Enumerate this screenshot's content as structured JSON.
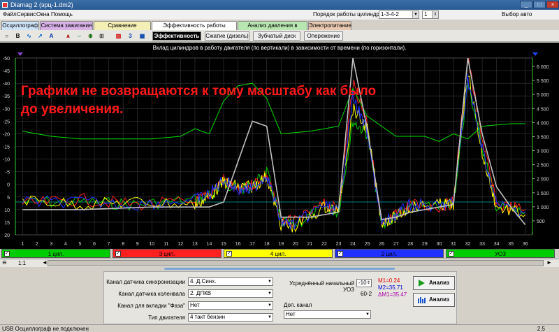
{
  "window": {
    "title": "Diamag 2 (эрц-1.dm2)"
  },
  "menu": {
    "items": [
      "Файл",
      "Сервис",
      "Окна",
      "Помощь"
    ],
    "cyl_order_label": "Порядок работы цилиндров",
    "cyl_order_value": "1-3-4-2",
    "spinner_value": "1",
    "auto_select": "Выбор авто"
  },
  "tabs": [
    {
      "label": "Осциллограф",
      "color": "#cfe3f7"
    },
    {
      "label": "Система зажигания",
      "color": "#d9b2e8"
    },
    {
      "label": "Сравнение цилиндров",
      "color": "#f4efb4"
    },
    {
      "label": "Эффективность работы цилиндров",
      "color": "#ffffff"
    },
    {
      "label": "Анализ давления в цилиндре",
      "color": "#b8e6b0"
    },
    {
      "label": "Электропитание",
      "color": "#e8c8b0"
    }
  ],
  "subtabs": [
    "Эффективность",
    "Сжатие (дизель)",
    "Зубчатый диск",
    "Опережение"
  ],
  "toolbar_icons": [
    "zoom-fit-icon",
    "bold-b-icon",
    "waveform-icon",
    "line-chart-icon",
    "scale-icon",
    "cylinder-icon",
    "expand-icon",
    "marker-icon",
    "compare-icon",
    "bar-chart-icon",
    "counter-icon",
    "grid-icon"
  ],
  "toolbar_icon_glyphs": [
    "○",
    "B",
    "∿",
    "↗",
    "A",
    "ѧ",
    "⇔",
    "⊕",
    "⊞",
    "▥",
    "3",
    "▦"
  ],
  "plot": {
    "title": "Вклад цилиндров в работу двигателя (по вертикали) в зависимости от времени (по горизонтали).",
    "annotation_line1": "Графики не возвращаются к тому масштабу как было",
    "annotation_line2": "до увеличения."
  },
  "chart_data": {
    "type": "line",
    "title": "Вклад цилиндров в работу двигателя (по вертикали) в зависимости от времени (по горизонтали).",
    "x_ticks": [
      1,
      2,
      3,
      4,
      5,
      6,
      7,
      8,
      9,
      10,
      11,
      12,
      13,
      14,
      15,
      16,
      17,
      18,
      19,
      20,
      21,
      22,
      23,
      24,
      25,
      26,
      27,
      28,
      29,
      30,
      31,
      32,
      33,
      34,
      35,
      36
    ],
    "xlim": [
      0.5,
      36.5
    ],
    "y_left_ticks": [
      "-50",
      "-45",
      "-40",
      "-35",
      "-30",
      "-25",
      "-20",
      "-15",
      "-10",
      "-5",
      "0",
      "5",
      "10",
      "15",
      "20"
    ],
    "ylim_left": [
      20,
      -50
    ],
    "y_right_ticks": [
      "6 000",
      "5 500",
      "5 000",
      "4 500",
      "4 000",
      "3 500",
      "3 000",
      "2 500",
      "2 000",
      "1 500",
      "1 000",
      "500"
    ],
    "ylim_right": [
      0,
      6300
    ],
    "grid": true,
    "series": [
      {
        "name": "1 цил.",
        "color": "#00cc00",
        "x": [
          1,
          5,
          9,
          13,
          14,
          15,
          16,
          17,
          18,
          19,
          20,
          22,
          23,
          24,
          25,
          26,
          27,
          28,
          30,
          31,
          32,
          33,
          34,
          36
        ],
        "y": [
          7,
          7,
          8,
          6,
          5,
          -1,
          2,
          1,
          -5,
          15,
          16,
          9,
          11,
          -25,
          -20,
          16,
          13,
          9,
          8,
          8,
          -40,
          -15,
          9,
          11
        ]
      },
      {
        "name": "3 цил.",
        "color": "#ff2020",
        "x": [
          1,
          5,
          9,
          13,
          14,
          15,
          16,
          17,
          18,
          19,
          20,
          22,
          23,
          24,
          25,
          26,
          27,
          28,
          30,
          31,
          32,
          33,
          34,
          36
        ],
        "y": [
          8,
          6,
          8,
          7,
          4,
          -2,
          3,
          0,
          -4,
          14,
          15,
          8,
          10,
          -40,
          -25,
          17,
          12,
          8,
          9,
          7,
          -50,
          -18,
          8,
          10
        ]
      },
      {
        "name": "4 цил.",
        "color": "#ffff00",
        "x": [
          1,
          5,
          9,
          13,
          14,
          15,
          16,
          17,
          18,
          19,
          20,
          22,
          23,
          24,
          25,
          26,
          27,
          28,
          30,
          31,
          32,
          33,
          34,
          36
        ],
        "y": [
          6,
          8,
          7,
          8,
          5,
          -1,
          1,
          1,
          -3,
          16,
          17,
          9,
          10,
          -30,
          -22,
          15,
          13,
          9,
          8,
          8,
          -45,
          -12,
          9,
          12
        ]
      },
      {
        "name": "2 цил.",
        "color": "#2030ff",
        "x": [
          1,
          5,
          9,
          13,
          14,
          15,
          16,
          17,
          18,
          19,
          20,
          22,
          23,
          24,
          25,
          26,
          27,
          28,
          30,
          31,
          32,
          33,
          34,
          36
        ],
        "y": [
          7,
          7,
          8,
          6,
          4,
          -2,
          2,
          2,
          -4,
          15,
          16,
          8,
          11,
          -35,
          -20,
          16,
          12,
          8,
          9,
          7,
          -42,
          -14,
          8,
          11
        ]
      },
      {
        "name": "УОЗ",
        "color": "#00dd00",
        "x": [
          1,
          3,
          5,
          8,
          10,
          12,
          13,
          14,
          15,
          16,
          17,
          18,
          19,
          21,
          23,
          24,
          25,
          27,
          29,
          30,
          31,
          32,
          33,
          35,
          36
        ],
        "y": [
          -21,
          -19,
          -18,
          -18,
          -18,
          -19,
          -22,
          -20,
          -33,
          -39,
          -40,
          -34,
          -20,
          -21,
          -23,
          -38,
          -27,
          -19,
          -19,
          -17,
          -20,
          -18,
          -23,
          -24,
          -24
        ]
      },
      {
        "name": "обороты",
        "color": "#c0c0c0",
        "x": [
          1,
          5,
          10,
          13,
          14,
          15,
          17,
          18,
          19,
          20,
          21,
          22,
          23,
          24,
          25,
          26,
          27,
          28,
          29,
          30,
          31,
          32,
          33,
          34,
          35,
          36
        ],
        "y": [
          10,
          10,
          9,
          9,
          9,
          7,
          -25,
          -23,
          13,
          13,
          13,
          12,
          11,
          -50,
          -22,
          14,
          13,
          11,
          10,
          9,
          8,
          -50,
          -20,
          1,
          9,
          16
        ]
      }
    ]
  },
  "channels": [
    {
      "label": "1 цил.",
      "color": "#00cc00",
      "text_color": "#000000"
    },
    {
      "label": "3 цил.",
      "color": "#ff2020",
      "text_color": "#000000"
    },
    {
      "label": "4 цил.",
      "color": "#ffff00",
      "text_color": "#000000"
    },
    {
      "label": "2 цил.",
      "color": "#2030ff",
      "text_color": "#000000"
    },
    {
      "label": "УОЗ",
      "color": "#00cc00",
      "text_color": "#000000"
    }
  ],
  "zoom": {
    "value": "1:1"
  },
  "form": {
    "sync_label": "Канал датчика синхронизации",
    "sync_value": "4. Д.Синх.",
    "crank_label": "Канал датчика коленвала",
    "crank_value": "2. ДПКВ",
    "phase_label": "Канал для вкладки \"Фаза\"",
    "phase_value": "Нет",
    "engine_label": "Тип двигателя",
    "engine_value": "4 такт бензин",
    "avg_uoz_label": "Усреднённый начальный УОЗ",
    "avg_uoz_value": "-10",
    "ratio": "60-2",
    "m1": "M1=0.24",
    "m2": "M2=35.71",
    "dm1": "ΔM1=35.47",
    "extra_label": "Доп. канал",
    "extra_value": "Нет",
    "analyze1": "Анализ",
    "analyze2": "Анализ"
  },
  "status": {
    "left": "USB Осциллограф не подключен",
    "right": "2.5"
  }
}
